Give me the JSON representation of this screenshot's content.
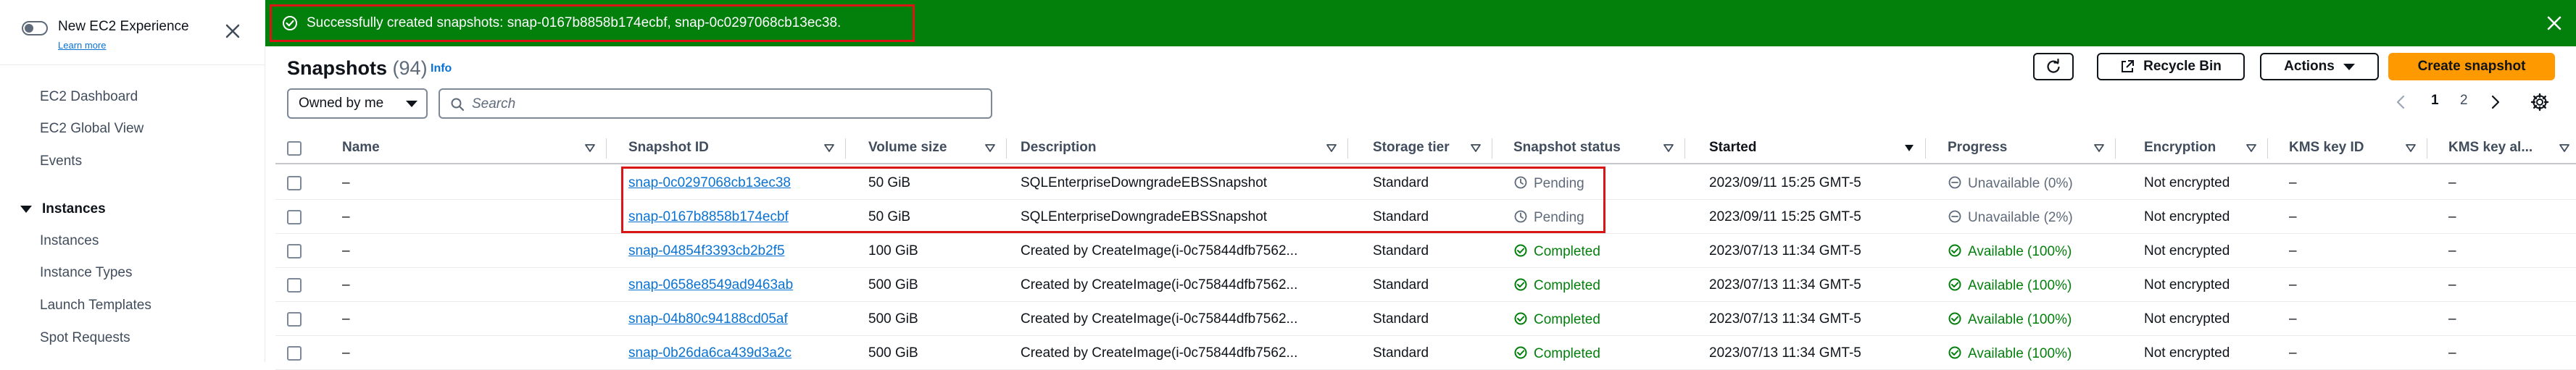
{
  "sidebar": {
    "toggle_label": "New EC2 Experience",
    "learn_more": "Learn more",
    "items": [
      "EC2 Dashboard",
      "EC2 Global View",
      "Events"
    ],
    "section": "Instances",
    "section_items": [
      "Instances",
      "Instance Types",
      "Launch Templates",
      "Spot Requests"
    ]
  },
  "notification": {
    "text": "Successfully created snapshots: snap-0167b8858b174ecbf, snap-0c0297068cb13ec38."
  },
  "header": {
    "title": "Snapshots",
    "count": "(94)",
    "info": "Info",
    "recycle_bin": "Recycle Bin",
    "actions": "Actions",
    "create": "Create snapshot"
  },
  "filter": {
    "owner": "Owned by me",
    "search_placeholder": "Search"
  },
  "pagination": {
    "pages": [
      "1",
      "2"
    ],
    "current": "1"
  },
  "table": {
    "columns": [
      "Name",
      "Snapshot ID",
      "Volume size",
      "Description",
      "Storage tier",
      "Snapshot status",
      "Started",
      "Progress",
      "Encryption",
      "KMS key ID",
      "KMS key al..."
    ],
    "rows": [
      {
        "name": "–",
        "id": "snap-0c0297068cb13ec38",
        "size": "50 GiB",
        "desc": "SQLEnterpriseDowngradeEBSSnapshot",
        "tier": "Standard",
        "status": "Pending",
        "started": "2023/09/11 15:25 GMT-5",
        "progress": "Unavailable (0%)",
        "enc": "Not encrypted",
        "kms": "–",
        "alias": "–"
      },
      {
        "name": "–",
        "id": "snap-0167b8858b174ecbf",
        "size": "50 GiB",
        "desc": "SQLEnterpriseDowngradeEBSSnapshot",
        "tier": "Standard",
        "status": "Pending",
        "started": "2023/09/11 15:25 GMT-5",
        "progress": "Unavailable (2%)",
        "enc": "Not encrypted",
        "kms": "–",
        "alias": "–"
      },
      {
        "name": "–",
        "id": "snap-04854f3393cb2b2f5",
        "size": "100 GiB",
        "desc": "Created by CreateImage(i-0c75844dfb7562...",
        "tier": "Standard",
        "status": "Completed",
        "started": "2023/07/13 11:34 GMT-5",
        "progress": "Available (100%)",
        "enc": "Not encrypted",
        "kms": "–",
        "alias": "–"
      },
      {
        "name": "–",
        "id": "snap-0658e8549ad9463ab",
        "size": "500 GiB",
        "desc": "Created by CreateImage(i-0c75844dfb7562...",
        "tier": "Standard",
        "status": "Completed",
        "started": "2023/07/13 11:34 GMT-5",
        "progress": "Available (100%)",
        "enc": "Not encrypted",
        "kms": "–",
        "alias": "–"
      },
      {
        "name": "–",
        "id": "snap-04b80c94188cd05af",
        "size": "500 GiB",
        "desc": "Created by CreateImage(i-0c75844dfb7562...",
        "tier": "Standard",
        "status": "Completed",
        "started": "2023/07/13 11:34 GMT-5",
        "progress": "Available (100%)",
        "enc": "Not encrypted",
        "kms": "–",
        "alias": "–"
      },
      {
        "name": "–",
        "id": "snap-0b26da6ca439d3a2c",
        "size": "500 GiB",
        "desc": "Created by CreateImage(i-0c75844dfb7562...",
        "tier": "Standard",
        "status": "Completed",
        "started": "2023/07/13 11:34 GMT-5",
        "progress": "Available (100%)",
        "enc": "Not encrypted",
        "kms": "–",
        "alias": "–"
      }
    ]
  },
  "colors": {
    "success": "#037f0c",
    "link": "#0972d3",
    "primary": "#ff9900",
    "highlight": "#d91515"
  }
}
